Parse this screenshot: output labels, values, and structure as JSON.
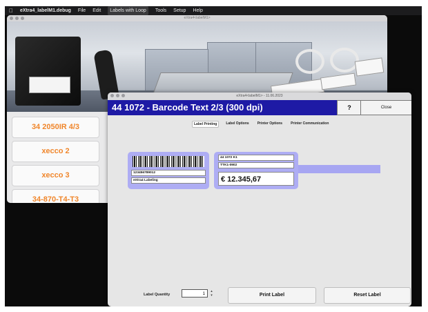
{
  "menubar": {
    "app": "eXtra4_labelM1.debug",
    "items": [
      "File",
      "Edit",
      "Labels with Loop",
      "Tools",
      "Setup",
      "Help"
    ]
  },
  "back_window": {
    "title": "eXtra4<labelM1>",
    "printers": [
      "34 2050IR 4/3",
      "xecco 2",
      "xecco 3",
      "34-870-T4-T3"
    ]
  },
  "front_window": {
    "title": "eXtra4<labelM1> - 11.06.2023",
    "header_title": "44 1072 - Barcode Text 2/3 (300 dpi)",
    "help_label": "?",
    "close_label": "Close",
    "tabs": [
      "Label Printing",
      "Label Options",
      "Printer Options",
      "Printer Communication"
    ],
    "label": {
      "barcode_number": "123456789012",
      "company": "eXtra4 Labeling",
      "article": "44 1072 K1",
      "code": "TTK1-0902",
      "price": "€ 12.345,67"
    },
    "quantity_label": "Label Quantity",
    "quantity_value": "1",
    "print_label": "Print Label",
    "reset_label": "Reset Label"
  },
  "colors": {
    "header_bg": "#1e1aa5",
    "label_highlight": "#aeadf4",
    "printer_text": "#f0862b"
  }
}
